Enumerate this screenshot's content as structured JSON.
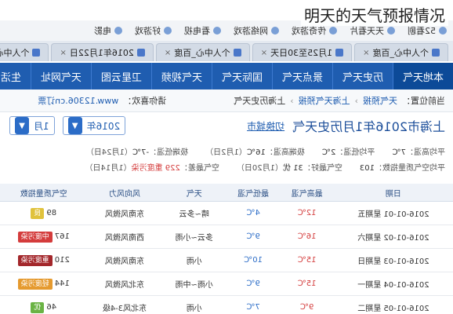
{
  "overlay_title": "明天的天气预报情况",
  "bookmarks": [
    {
      "label": "52看剧"
    },
    {
      "label": "天天看片"
    },
    {
      "label": "传奇游戏"
    },
    {
      "label": "网络游戏"
    },
    {
      "label": "看电视"
    },
    {
      "label": "好游戏"
    },
    {
      "label": "电影"
    }
  ],
  "tabs": [
    {
      "label": "个人中心_百度",
      "active": false
    },
    {
      "label": "1月25至30日天",
      "active": false
    },
    {
      "label": "个人中心_百度",
      "active": false
    },
    {
      "label": "2016年1月22日",
      "active": false
    },
    {
      "label": "个人中心_百度",
      "active": false
    },
    {
      "label": "2016年1月22日",
      "active": true
    }
  ],
  "nav": [
    {
      "label": "本地天气",
      "active": true
    },
    {
      "label": "历史天气",
      "active": false
    },
    {
      "label": "景点天气",
      "active": false
    },
    {
      "label": "国际天气",
      "active": false
    },
    {
      "label": "天气视频",
      "active": false
    },
    {
      "label": "卫星云图",
      "active": false
    },
    {
      "label": "天气网址",
      "active": false
    },
    {
      "label": "生活",
      "active": false
    }
  ],
  "breadcrumb": {
    "prefix": "当前位置：",
    "items": [
      "天气预报",
      "上海天气预报",
      "上海历史天气"
    ],
    "note": "请你喜欢：",
    "extra": "www.12306.cn订票"
  },
  "page_title": "上海市2016年1月历史天气",
  "city_link": "切换城市",
  "selects": {
    "year": "2016年",
    "month": "1月"
  },
  "summary": {
    "row1": [
      {
        "k": "平均高温：",
        "v": "7℃"
      },
      {
        "k": "平均低温：",
        "v": "2℃"
      },
      {
        "k": "极端高温：",
        "v": "16℃",
        "note": "（1月2日）"
      },
      {
        "k": "极端低温：",
        "v": "-7℃",
        "note": "（1月24日）"
      }
    ],
    "row2": [
      {
        "k": "平均空气质量指数：",
        "v": "103"
      },
      {
        "k": "空气最好：",
        "v": "31 优",
        "note": "（1月20日）"
      },
      {
        "k": "空气最差：",
        "v": "229 重度污染",
        "note": "（1月14日）"
      }
    ]
  },
  "table": {
    "headers": [
      "日期",
      "最高气温",
      "最低气温",
      "天气",
      "风向风力",
      "空气质量指数"
    ],
    "rows": [
      {
        "date": "2016-01-01",
        "week": "星期五",
        "high": "12℃",
        "low": "4℃",
        "weather": "晴~多云",
        "wind": "东南风微风",
        "aqi": "89",
        "aq_level": "良",
        "aq_color": "#e0c23c"
      },
      {
        "date": "2016-01-02",
        "week": "星期六",
        "high": "16℃",
        "low": "9℃",
        "weather": "多云~小雨",
        "wind": "西南风微风",
        "aqi": "167",
        "aq_level": "中度污染",
        "aq_color": "#d43c3c"
      },
      {
        "date": "2016-01-03",
        "week": "星期日",
        "high": "15℃",
        "low": "10℃",
        "weather": "小雨",
        "wind": "东南风微风",
        "aqi": "210",
        "aq_level": "重度污染",
        "aq_color": "#a3272b"
      },
      {
        "date": "2016-01-04",
        "week": "星期一",
        "high": "15℃",
        "low": "9℃",
        "weather": "小雨~中雨",
        "wind": "东北风微风",
        "aqi": "144",
        "aq_level": "轻度污染",
        "aq_color": "#e59a2f"
      },
      {
        "date": "2016-01-05",
        "week": "星期二",
        "high": "9℃",
        "low": "7℃",
        "weather": "小雨",
        "wind": "东北风3-4级",
        "aqi": "46",
        "aq_level": "优",
        "aq_color": "#6ab344"
      }
    ]
  }
}
